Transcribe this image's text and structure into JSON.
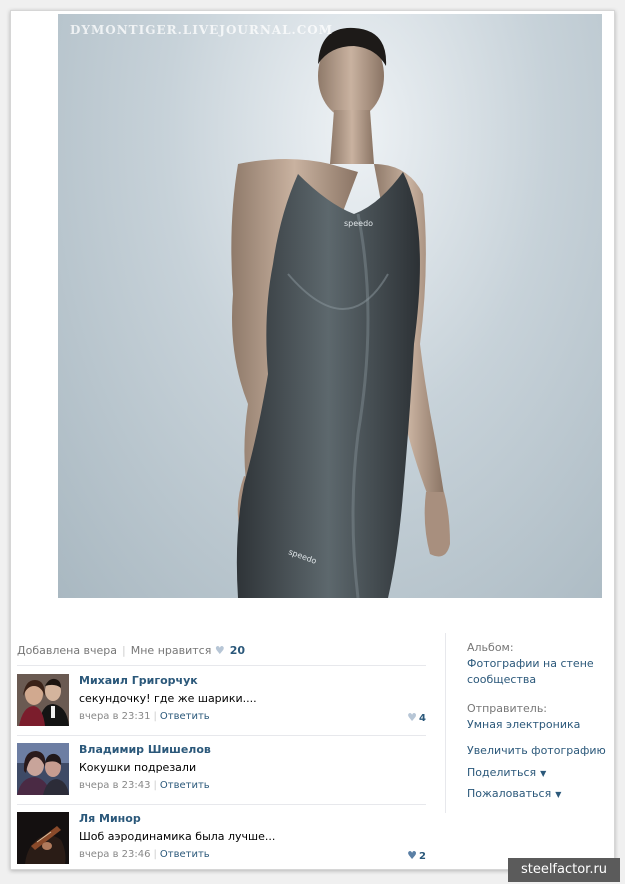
{
  "photo": {
    "watermark": "DYMONTIGER.LIVEJOURNAL.COM",
    "brand_mark": "Speedo"
  },
  "meta": {
    "added": "Добавлена вчера",
    "like_label": "Мне нравится",
    "like_count": "20"
  },
  "comments": [
    {
      "author": "Михаил Григорчук",
      "text": "секундочку! где же шарики....",
      "time": "вчера в 23:31",
      "reply": "Ответить",
      "likes": "4"
    },
    {
      "author": "Владимир Шишелов",
      "text": "Кокушки подрезали",
      "time": "вчера в 23:43",
      "reply": "Ответить",
      "likes": ""
    },
    {
      "author": "Ля Минор",
      "text": "Шоб аэродинамика была лучше...",
      "time": "вчера в 23:46",
      "reply": "Ответить",
      "likes": "2"
    }
  ],
  "sidebar": {
    "album_label": "Альбом:",
    "album_line1": "Фотографии на стене",
    "album_line2": "сообщества",
    "sender_label": "Отправитель:",
    "sender_name": "Умная электроника",
    "enlarge": "Увеличить фотографию",
    "share": "Поделиться",
    "report": "Пожаловаться"
  },
  "badge": {
    "site": "steelfactor.ru"
  },
  "icons": {
    "heart": "heart-icon",
    "dropdown": "chevron-down-icon"
  },
  "colors": {
    "link": "#2b587a",
    "muted": "#777777",
    "heart": "#b7c6d6"
  }
}
